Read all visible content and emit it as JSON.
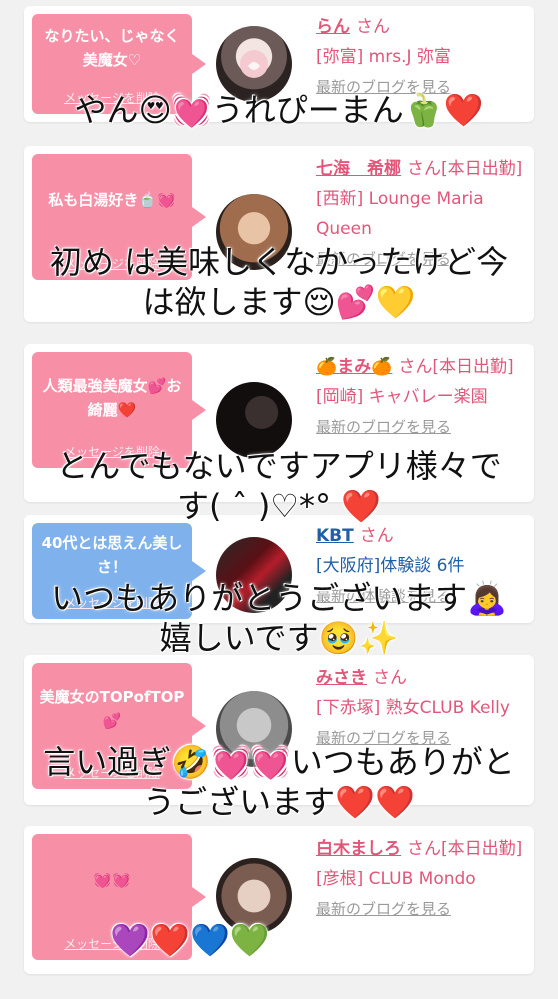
{
  "cards": [
    {
      "bubble_text": "なりたい、じゃなく美魔女♡",
      "bubble_color": "#f78fa7",
      "delete_label": "メッセージを削除",
      "name": "らん",
      "san": "さん",
      "status": "",
      "sub": "[弥富] mrs.J 弥富",
      "blog_label": "最新のブログを見る"
    },
    {
      "bubble_text": "私も白湯好き🍵💓",
      "bubble_color": "#f78fa7",
      "delete_label": "メッセージを削除",
      "name": "七海　希梛",
      "san": "さん[本日出勤]",
      "sub": "[西新] Lounge Maria Queen",
      "blog_label": "最新のブログを見る"
    },
    {
      "bubble_text": "人類最強美魔女💕お綺麗❤️",
      "bubble_color": "#f78fa7",
      "delete_label": "メッセージを削除",
      "name": "🍊まみ🍊",
      "san": "さん[本日出勤]",
      "sub": "[岡崎] キャバレー楽園",
      "blog_label": "最新のブログを見る"
    },
    {
      "bubble_text": "40代とは思えん美しさ！",
      "bubble_color": "#7fb2ec",
      "delete_label": "メッセージを削除",
      "name": "KBT",
      "san": "さん",
      "sub": "[大阪府]体験談 6件",
      "blog_label": "最新の体験談を見る"
    },
    {
      "bubble_text": "美魔女のTOPofTOP💕",
      "bubble_color": "#f78fa7",
      "delete_label": "メッセージを削除",
      "name": "みさき",
      "san": "さん",
      "sub": "[下赤塚] 熟女CLUB Kelly",
      "blog_label": "最新のブログを見る"
    },
    {
      "bubble_text": "💓💓",
      "bubble_color": "#f78fa7",
      "delete_label": "メッセージを削除",
      "name": "白木ましろ",
      "san": "さん[本日出勤]",
      "sub": "[彦根] CLUB Mondo",
      "blog_label": "最新のブログを見る"
    }
  ],
  "overlays": [
    {
      "line1": "やん😍💓うれぴーまん🫑❤️",
      "line2": ""
    },
    {
      "line1": "初め は美味しくなかったけど今",
      "line2": "は欲します😌💕💛"
    },
    {
      "line1": "とんでもないですアプリ様々で",
      "line2": "す( ˆ )♡*° ❤️"
    },
    {
      "line1": "いつもありがとうございます🙇‍♀️",
      "line2": "嬉しいです🥹✨"
    },
    {
      "line1": "言い過ぎ🤣💓💓いつもありがと",
      "line2": "うございます❤️❤️"
    },
    {
      "line1": "💜❤️💙💚",
      "line2": ""
    }
  ],
  "colors": {
    "pink_text": "#e2567a",
    "link_blue": "#1f5ea8",
    "bubble_pink": "#f78fa7",
    "bubble_blue": "#7fb2ec"
  }
}
